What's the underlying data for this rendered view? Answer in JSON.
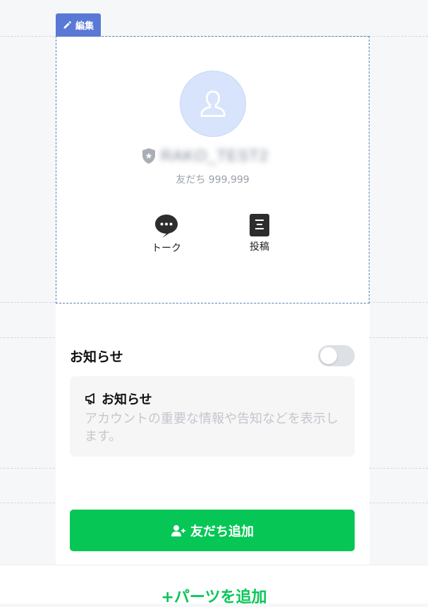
{
  "editor": {
    "edit_label": "編集",
    "add_parts_label": "+パーツを追加"
  },
  "profile": {
    "account_name": "RAKO_TEST2",
    "friends_text": "友だち 999,999",
    "actions": [
      {
        "label": "トーク",
        "icon": "chat-bubble-icon"
      },
      {
        "label": "投稿",
        "icon": "post-document-icon"
      }
    ]
  },
  "notice": {
    "section_title": "お知らせ",
    "toggle_on": false,
    "card_title": "お知らせ",
    "card_description": "アカウントの重要な情報や告知などを表示します。"
  },
  "add_friend": {
    "label": "友だち追加"
  },
  "colors": {
    "accent_green": "#06c755",
    "edit_tab_blue": "#5a79d6",
    "avatar_bg": "#d7e4fb"
  }
}
